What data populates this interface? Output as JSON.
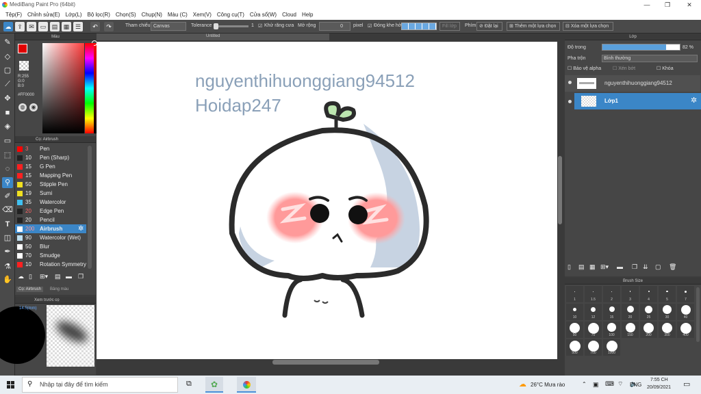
{
  "window": {
    "title": "MediBang Paint Pro (64bit)"
  },
  "menu": [
    "Tệp(F)",
    "Chỉnh sửa(E)",
    "Lớp(L)",
    "Bộ lọc(R)",
    "Chọn(S)",
    "Chụp(N)",
    "Màu (C)",
    "Xem(V)",
    "Công cụ(T)",
    "Cửa sổ(W)",
    "Cloud",
    "Help"
  ],
  "toolbar": {
    "reference_label": "Tham chiếu",
    "reference_value": "Canvas",
    "tolerance_label": "Tolerance",
    "tolerance_value": "1",
    "antialias_label": "Khử răng cưa",
    "expand_label": "Mở rộng",
    "expand_value": "0",
    "expand_unit": "pixel",
    "close_gap_label": "Đóng khe hở",
    "fill_label": "Fill lớp",
    "snap_label": "Phím",
    "reset_label": "Đặt lại",
    "add_selection_label": "Thêm một lựa chọn",
    "remove_selection_label": "Xóa một lựa chọn"
  },
  "color_panel": {
    "title": "Màu",
    "primary_color": "#e00000",
    "r": "R:255",
    "g": "G:0",
    "b": "B:0",
    "hex": "#FF0000"
  },
  "brush_panel": {
    "title": "Cọ: Airbrush",
    "items": [
      {
        "size": "3",
        "name": "Pen",
        "color": "#ff0000"
      },
      {
        "size": "10",
        "name": "Pen (Sharp)",
        "color": "#222222"
      },
      {
        "size": "15",
        "name": "G Pen",
        "color": "#ff2020"
      },
      {
        "size": "15",
        "name": "Mapping Pen",
        "color": "#ff2020"
      },
      {
        "size": "50",
        "name": "Stipple Pen",
        "color": "#f0e020"
      },
      {
        "size": "19",
        "name": "Sumi",
        "color": "#f0e020"
      },
      {
        "size": "35",
        "name": "Watercolor",
        "color": "#40c0f0"
      },
      {
        "size": "20",
        "name": "Edge Pen",
        "color": "#222222"
      },
      {
        "size": "20",
        "name": "Pencil",
        "color": "#222222"
      },
      {
        "size": "200",
        "name": "Airbrush",
        "color": "#ffffff"
      },
      {
        "size": "90",
        "name": "Watercolor (Wet)",
        "color": "#c0e0f0"
      },
      {
        "size": "50",
        "name": "Blur",
        "color": "#ffffff"
      },
      {
        "size": "70",
        "name": "Smudge",
        "color": "#ffffff"
      },
      {
        "size": "10",
        "name": "Rotation Symmetry",
        "color": "#ff2020"
      }
    ],
    "tab1": "Cọ: Airbrush",
    "tab2": "Bảng màu"
  },
  "preview_panel": {
    "title": "Xem trước cọ",
    "label": "14.5(mm)"
  },
  "canvas": {
    "title": "Untitled",
    "watermark1": "nguyenthihuonggiang94512",
    "watermark2": "Hoidap247"
  },
  "layer_panel": {
    "title": "Lớp",
    "opacity_label": "Độ trong",
    "opacity_value": "82 %",
    "opacity_fraction": 0.82,
    "blend_label": "Pha trộn",
    "blend_value": "Bình thường",
    "protect_alpha": "Bảo vệ alpha",
    "clipping": "Xén bớt",
    "lock": "Khóa",
    "layers": [
      {
        "name": "nguyenthihuonggiang94512",
        "selected": false
      },
      {
        "name": "Lớp1",
        "selected": true
      }
    ]
  },
  "brush_size_panel": {
    "title": "Brush Size",
    "sizes": [
      "1",
      "1.5",
      "2",
      "3",
      "4",
      "5",
      "7",
      "10",
      "12",
      "15",
      "20",
      "25",
      "30",
      "40",
      "50",
      "70",
      "100",
      "150",
      "200",
      "300",
      "400",
      "500",
      "700",
      "1000"
    ]
  },
  "taskbar": {
    "search_placeholder": "Nhập tại đây để tìm kiếm",
    "weather": "26°C  Mưa rào",
    "lang": "ENG",
    "time": "7:55 CH",
    "date": "20/09/2021"
  }
}
